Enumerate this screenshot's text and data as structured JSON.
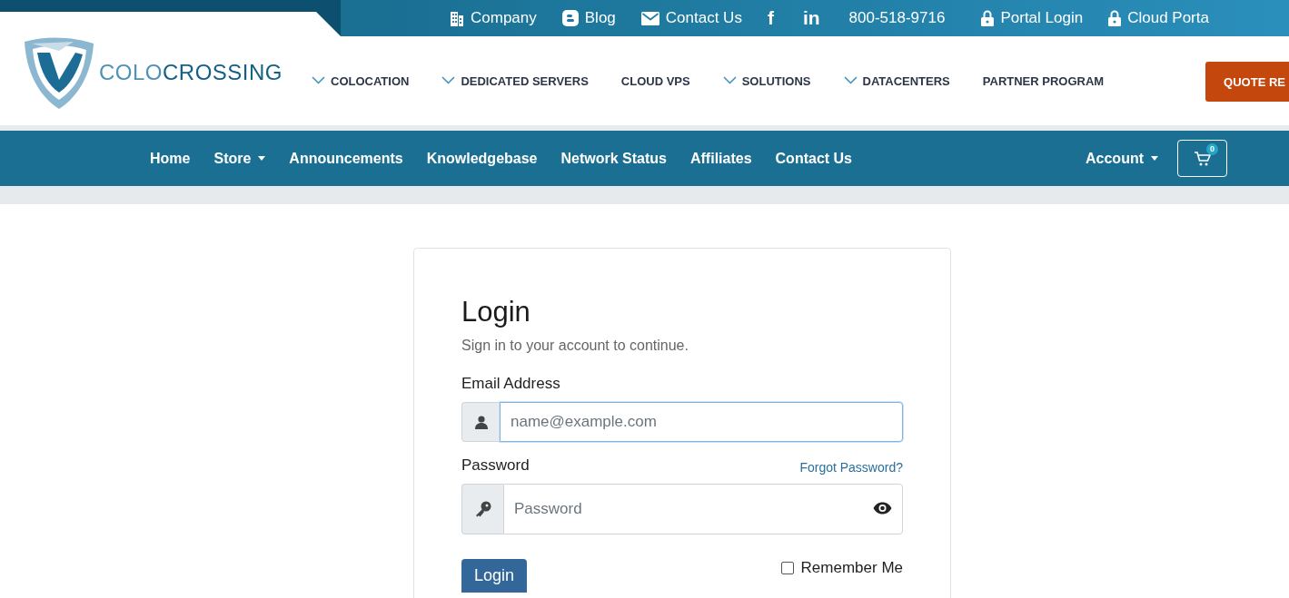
{
  "top_links": [
    {
      "kind": "company",
      "label": "Company"
    },
    {
      "kind": "blog",
      "label": "Blog"
    },
    {
      "kind": "mail",
      "label": "Contact Us"
    },
    {
      "kind": "social",
      "label": "f"
    },
    {
      "kind": "social",
      "label": "in"
    },
    {
      "kind": "text",
      "label": "800-518-9716"
    },
    {
      "kind": "lock",
      "label": "Portal Login"
    },
    {
      "kind": "lock",
      "label": "Cloud Porta"
    }
  ],
  "logo": {
    "parts": [
      "COLO",
      "CROSSING"
    ]
  },
  "main_nav": [
    {
      "label": "COLOCATION",
      "has_dropdown": true
    },
    {
      "label": "DEDICATED SERVERS",
      "has_dropdown": true
    },
    {
      "label": "CLOUD VPS",
      "has_dropdown": false
    },
    {
      "label": "SOLUTIONS",
      "has_dropdown": true
    },
    {
      "label": "DATACENTERS",
      "has_dropdown": true
    },
    {
      "label": "PARTNER PROGRAM",
      "has_dropdown": false
    }
  ],
  "quote_button": "QUOTE RE",
  "client_nav": {
    "items": [
      {
        "label": "Home",
        "has_caret": false
      },
      {
        "label": "Store",
        "has_caret": true
      },
      {
        "label": "Announcements",
        "has_caret": false
      },
      {
        "label": "Knowledgebase",
        "has_caret": false
      },
      {
        "label": "Network Status",
        "has_caret": false
      },
      {
        "label": "Affiliates",
        "has_caret": false
      },
      {
        "label": "Contact Us",
        "has_caret": false
      }
    ],
    "account": {
      "label": "Account",
      "has_caret": true
    },
    "cart_count": "0"
  },
  "login": {
    "title": "Login",
    "subtitle": "Sign in to your account to continue.",
    "email": {
      "label": "Email Address",
      "placeholder": "name@example.com",
      "focused": true
    },
    "password": {
      "label": "Password",
      "placeholder": "Password"
    },
    "forgot_link": "Forgot Password?",
    "remember": {
      "label": "Remember Me",
      "checked": false
    },
    "button": "Login"
  }
}
